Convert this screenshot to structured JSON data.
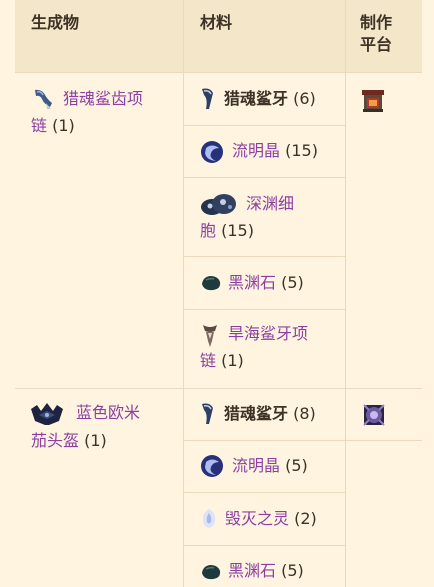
{
  "headers": {
    "result": "生成物",
    "materials": "材料",
    "station_line1": "制作",
    "station_line2": "平台"
  },
  "recipes": [
    {
      "result": {
        "name_line1": "猎魂鲨齿项",
        "name_line2": "链",
        "qty": "(1)",
        "icon": "necklace-icon"
      },
      "station_icon": "furnace-icon",
      "materials": [
        {
          "name": "猎魂鲨牙",
          "qty": "(6)",
          "icon": "shark-tooth-icon",
          "bold": true
        },
        {
          "name": "流明晶",
          "qty": "(15)",
          "icon": "lumenyl-icon"
        },
        {
          "name_line1": "深渊细",
          "name_line2": "胞",
          "qty": "(15)",
          "icon": "depth-cells-icon"
        },
        {
          "name": "黑渊石",
          "qty": "(5)",
          "icon": "scoria-ore-icon"
        },
        {
          "name_line1": "旱海鲨牙项",
          "name_line2": "链",
          "qty": "(1)",
          "icon": "sand-shark-necklace-icon"
        }
      ]
    },
    {
      "result": {
        "name_line1": "蓝色欧米",
        "name_line2": "茄头盔",
        "qty": "(1)",
        "icon": "omega-helmet-icon"
      },
      "station_icon": "cosmic-anvil-icon",
      "materials": [
        {
          "name": "猎魂鲨牙",
          "qty": "(8)",
          "icon": "shark-tooth-icon",
          "bold": true
        },
        {
          "name": "流明晶",
          "qty": "(5)",
          "icon": "lumenyl-icon"
        },
        {
          "name": "毁灭之灵",
          "qty": "(2)",
          "icon": "ruin-spirit-icon"
        },
        {
          "name": "黑渊石",
          "qty": "(5)",
          "icon": "scoria-ore-icon"
        }
      ]
    }
  ]
}
